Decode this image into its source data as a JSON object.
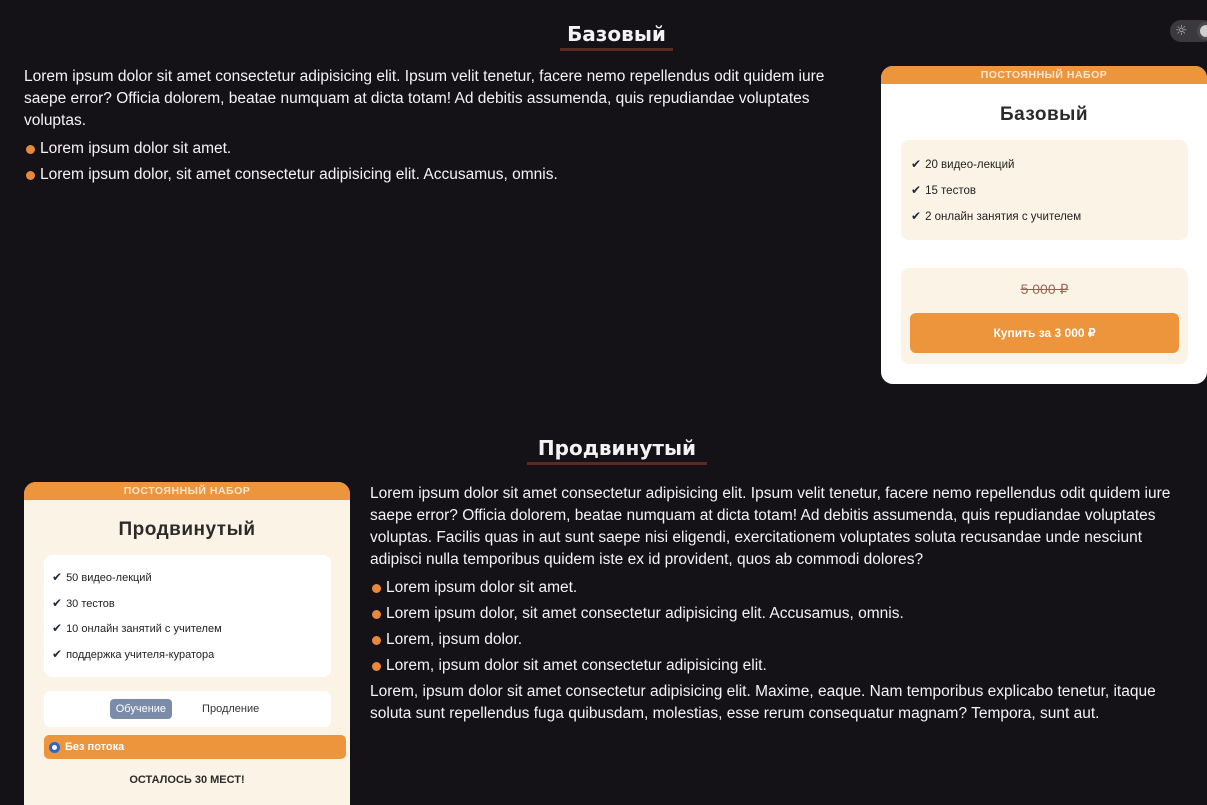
{
  "theme": {
    "toggle_icon": "sun-icon"
  },
  "sections": {
    "basic": {
      "title": "Базовый",
      "paragraph": "Lorem ipsum dolor sit amet consectetur adipisicing elit. Ipsum velit tenetur, facere nemo repellendus odit quidem iure saepe error? Officia dolorem, beatae numquam at dicta totam! Ad debitis assumenda, quis repudiandae voluptates voluptas.",
      "bullets": [
        "Lorem ipsum dolor sit amet.",
        "Lorem ipsum dolor, sit amet consectetur adipisicing elit. Accusamus, omnis."
      ]
    },
    "advanced": {
      "title": "Продвинутый",
      "paragraph": "Lorem ipsum dolor sit amet consectetur adipisicing elit. Ipsum velit tenetur, facere nemo repellendus odit quidem iure saepe error? Officia dolorem, beatae numquam at dicta totam! Ad debitis assumenda, quis repudiandae voluptates voluptas. Facilis quas in aut sunt saepe nisi eligendi, exercitationem voluptates soluta recusandae unde nesciunt adipisci nulla temporibus quidem iste ex id provident, quos ab commodi dolores?",
      "bullets": [
        "Lorem ipsum dolor sit amet.",
        "Lorem ipsum dolor, sit amet consectetur adipisicing elit. Accusamus, omnis.",
        "Lorem, ipsum dolor.",
        "Lorem, ipsum dolor sit amet consectetur adipisicing elit."
      ],
      "paragraph2": "Lorem, ipsum dolor sit amet consectetur adipisicing elit. Maxime, eaque. Nam temporibus explicabo tenetur, itaque soluta sunt repellendus fuga quibusdam, molestias, esse rerum consequatur magnam? Tempora, sunt aut."
    }
  },
  "cards": {
    "basic": {
      "ribbon": "ПОСТОЯННЫЙ НАБОР",
      "title": "Базовый",
      "features": [
        "20 видео-лекций",
        "15 тестов",
        "2 онлайн занятия с учителем"
      ],
      "old_price": "5 000 ₽",
      "buy_label": "Купить за 3 000 ₽"
    },
    "advanced": {
      "ribbon": "ПОСТОЯННЫЙ НАБОР",
      "title": "Продвинутый",
      "features": [
        "50 видео-лекций",
        "30 тестов",
        "10 онлайн занятий с учителем",
        "поддержка учителя-куратора"
      ],
      "tabs": [
        "Обучение",
        "Продление"
      ],
      "active_tab": "Обучение",
      "stream_option": "Без потока",
      "seats_left": "ОСТАЛОСЬ 30 МЕСТ!"
    }
  },
  "colors": {
    "accent": "#ec953c",
    "background": "#141217",
    "card_cream": "#fbf3e6"
  }
}
